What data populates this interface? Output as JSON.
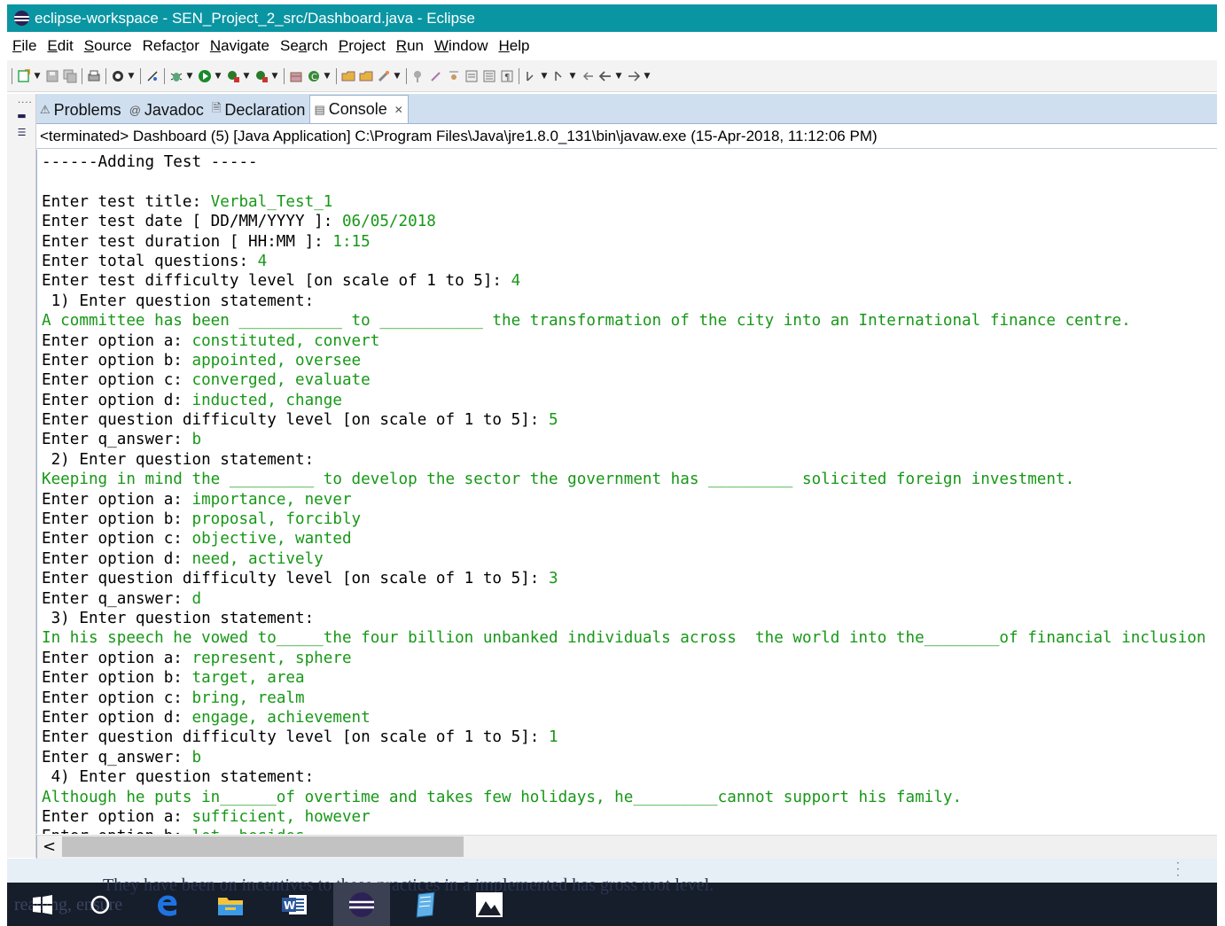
{
  "window": {
    "title": "eclipse-workspace - SEN_Project_2_src/Dashboard.java - Eclipse"
  },
  "menu": [
    {
      "label": "File",
      "mnemonic": "F",
      "rest": "ile"
    },
    {
      "label": "Edit",
      "mnemonic": "E",
      "rest": "dit"
    },
    {
      "label": "Source",
      "mnemonic": "S",
      "rest": "ource"
    },
    {
      "label": "Refactor",
      "pre": "Refac",
      "mnemonic": "t",
      "rest": "or"
    },
    {
      "label": "Navigate",
      "mnemonic": "N",
      "rest": "avigate"
    },
    {
      "label": "Search",
      "pre": "Se",
      "mnemonic": "a",
      "rest": "rch"
    },
    {
      "label": "Project",
      "mnemonic": "P",
      "rest": "roject"
    },
    {
      "label": "Run",
      "mnemonic": "R",
      "rest": "un"
    },
    {
      "label": "Window",
      "mnemonic": "W",
      "rest": "indow"
    },
    {
      "label": "Help",
      "mnemonic": "H",
      "rest": "elp"
    }
  ],
  "tabs": [
    {
      "label": "Problems",
      "icon": "problems-icon",
      "glyph": "⚠"
    },
    {
      "label": "Javadoc",
      "icon": "javadoc-icon",
      "glyph": "@"
    },
    {
      "label": "Declaration",
      "icon": "declaration-icon",
      "glyph": "🗎"
    },
    {
      "label": "Console",
      "icon": "console-icon",
      "glyph": "▤",
      "close": "✕"
    }
  ],
  "console": {
    "header": "<terminated> Dashboard (5) [Java Application] C:\\Program Files\\Java\\jre1.8.0_131\\bin\\javaw.exe (15-Apr-2018, 11:12:06 PM)",
    "lines": [
      {
        "p": "------Adding Test -----",
        "i": ""
      },
      {
        "p": "",
        "i": ""
      },
      {
        "p": "Enter test title: ",
        "i": "Verbal_Test_1"
      },
      {
        "p": "Enter test date [ DD/MM/YYYY ]: ",
        "i": "06/05/2018"
      },
      {
        "p": "Enter test duration [ HH:MM ]: ",
        "i": "1:15"
      },
      {
        "p": "Enter total questions: ",
        "i": "4"
      },
      {
        "p": "Enter test difficulty level [on scale of 1 to 5]: ",
        "i": "4"
      },
      {
        "p": " 1) Enter question statement:",
        "i": ""
      },
      {
        "p": "",
        "i": "A committee has been ___________ to ___________ the transformation of the city into an International finance centre."
      },
      {
        "p": "Enter option a: ",
        "i": "constituted, convert"
      },
      {
        "p": "Enter option b: ",
        "i": "appointed, oversee"
      },
      {
        "p": "Enter option c: ",
        "i": "converged, evaluate"
      },
      {
        "p": "Enter option d: ",
        "i": "inducted, change"
      },
      {
        "p": "Enter question difficulty level [on scale of 1 to 5]: ",
        "i": "5"
      },
      {
        "p": "Enter q_answer: ",
        "i": "b"
      },
      {
        "p": " 2) Enter question statement:",
        "i": ""
      },
      {
        "p": "",
        "i": "Keeping in mind the _________ to develop the sector the government has _________ solicited foreign investment."
      },
      {
        "p": "Enter option a: ",
        "i": "importance, never"
      },
      {
        "p": "Enter option b: ",
        "i": "proposal, forcibly"
      },
      {
        "p": "Enter option c: ",
        "i": "objective, wanted"
      },
      {
        "p": "Enter option d: ",
        "i": "need, actively"
      },
      {
        "p": "Enter question difficulty level [on scale of 1 to 5]: ",
        "i": "3"
      },
      {
        "p": "Enter q_answer: ",
        "i": "d"
      },
      {
        "p": " 3) Enter question statement:",
        "i": ""
      },
      {
        "p": "",
        "i": "In his speech he vowed to_____the four billion unbanked individuals across  the world into the________of financial inclusion"
      },
      {
        "p": "Enter option a: ",
        "i": "represent, sphere"
      },
      {
        "p": "Enter option b: ",
        "i": "target, area"
      },
      {
        "p": "Enter option c: ",
        "i": "bring, realm"
      },
      {
        "p": "Enter option d: ",
        "i": "engage, achievement"
      },
      {
        "p": "Enter question difficulty level [on scale of 1 to 5]: ",
        "i": "1"
      },
      {
        "p": "Enter q_answer: ",
        "i": "b"
      },
      {
        "p": " 4) Enter question statement:",
        "i": ""
      },
      {
        "p": "",
        "i": "Although he puts in______of overtime and takes few holidays, he_________cannot support his family."
      },
      {
        "p": "Enter option a: ",
        "i": "sufficient, however"
      },
      {
        "p": "Enter option b: ",
        "i": "lot, besides"
      }
    ]
  },
  "scroll": {
    "left_arrow": "<",
    "horizontal_position": 0
  },
  "taskbar": {
    "bleed_text": "They have been              on incentives to               these practices in a implemented has gross root level.",
    "bleed_text_2": "reading, ensure",
    "items": [
      "start-icon",
      "cortana-icon",
      "edge-icon",
      "file-explorer-icon",
      "word-icon",
      "eclipse-icon",
      "notepad-icon",
      "photos-icon"
    ]
  },
  "colors": {
    "title_bar": "#0a95a3",
    "console_input": "#179817",
    "console_output": "#000000",
    "tab_strip": "#cfdff0",
    "taskbar": "#161d2b"
  }
}
